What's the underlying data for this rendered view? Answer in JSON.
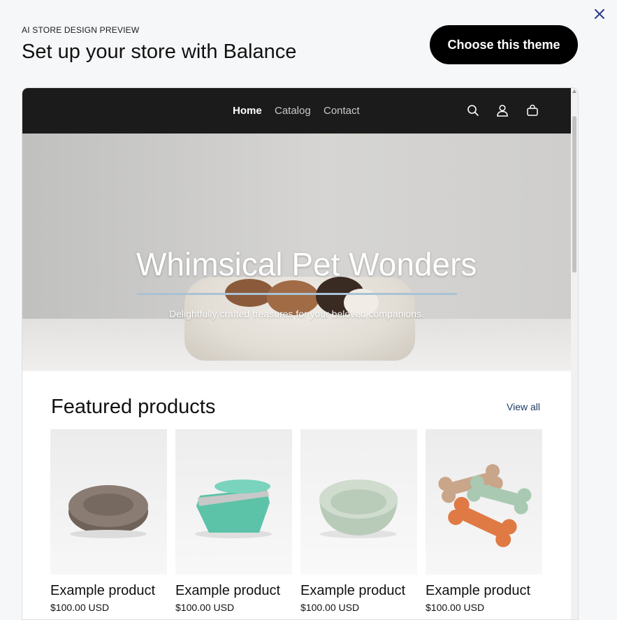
{
  "header": {
    "eyebrow": "AI STORE DESIGN PREVIEW",
    "title": "Set up your store with Balance",
    "choose_label": "Choose this theme",
    "close_icon": "close-icon"
  },
  "store": {
    "nav": [
      {
        "label": "Home",
        "active": true
      },
      {
        "label": "Catalog",
        "active": false
      },
      {
        "label": "Contact",
        "active": false
      }
    ],
    "icons": [
      "search-icon",
      "account-icon",
      "cart-icon"
    ],
    "hero": {
      "title": "Whimsical Pet Wonders",
      "subtitle": "Delightfully crafted treasures for your beloved companions."
    },
    "featured": {
      "title": "Featured products",
      "view_all": "View all",
      "products": [
        {
          "name": "Example product",
          "price": "$100.00 USD",
          "image": "pet-bed-image"
        },
        {
          "name": "Example product",
          "price": "$100.00 USD",
          "image": "litter-box-image"
        },
        {
          "name": "Example product",
          "price": "$100.00 USD",
          "image": "pet-bowl-image"
        },
        {
          "name": "Example product",
          "price": "$100.00 USD",
          "image": "bone-toys-image"
        }
      ]
    }
  },
  "colors": {
    "page_bg": "#f6f7f9",
    "store_header": "#1b1b1b",
    "button": "#000000",
    "hero_underline": "#a9c2d6",
    "link": "#1f3b64",
    "close_icon": "#2b3a8c"
  }
}
